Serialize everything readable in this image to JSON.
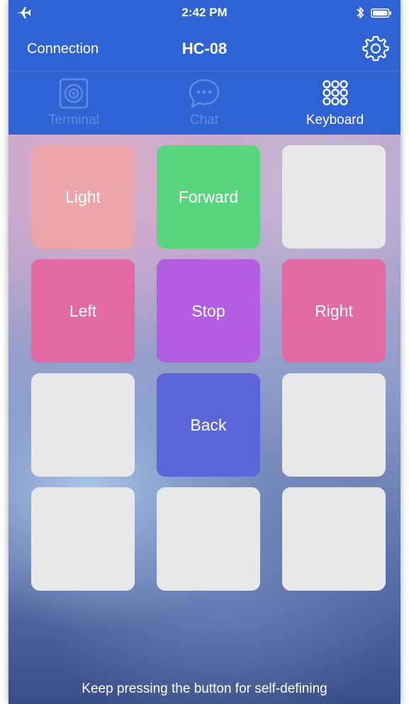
{
  "status_bar": {
    "time": "2:42 PM",
    "icons": [
      "airplane-icon",
      "bluetooth-icon",
      "battery-icon"
    ]
  },
  "nav": {
    "left_label": "Connection",
    "title": "HC-08",
    "right_icon": "gear-icon"
  },
  "tabs": [
    {
      "label": "Terminal",
      "icon": "speaker-icon",
      "active": false
    },
    {
      "label": "Chat",
      "icon": "chat-bubble-icon",
      "active": false
    },
    {
      "label": "Keyboard",
      "icon": "keypad-icon",
      "active": true
    }
  ],
  "keys": [
    {
      "label": "Light",
      "color": "#eba5ab"
    },
    {
      "label": "Forward",
      "color": "#5ad57f"
    },
    {
      "label": "",
      "color": "#e8e8e8"
    },
    {
      "label": "Left",
      "color": "#e26aa3"
    },
    {
      "label": "Stop",
      "color": "#b15ee0"
    },
    {
      "label": "Right",
      "color": "#e26aa3"
    },
    {
      "label": "",
      "color": "#e8e8e8"
    },
    {
      "label": "Back",
      "color": "#5d63d8"
    },
    {
      "label": "",
      "color": "#e8e8e8"
    },
    {
      "label": "",
      "color": "#e8e8e8"
    },
    {
      "label": "",
      "color": "#e8e8e8"
    },
    {
      "label": "",
      "color": "#e8e8e8"
    }
  ],
  "footer": {
    "hint": "Keep pressing the button for self-defining"
  },
  "colors": {
    "bar_blue": "#2f62d3",
    "inactive_tab": "#5f8be6",
    "active_tab": "#ffffff"
  }
}
